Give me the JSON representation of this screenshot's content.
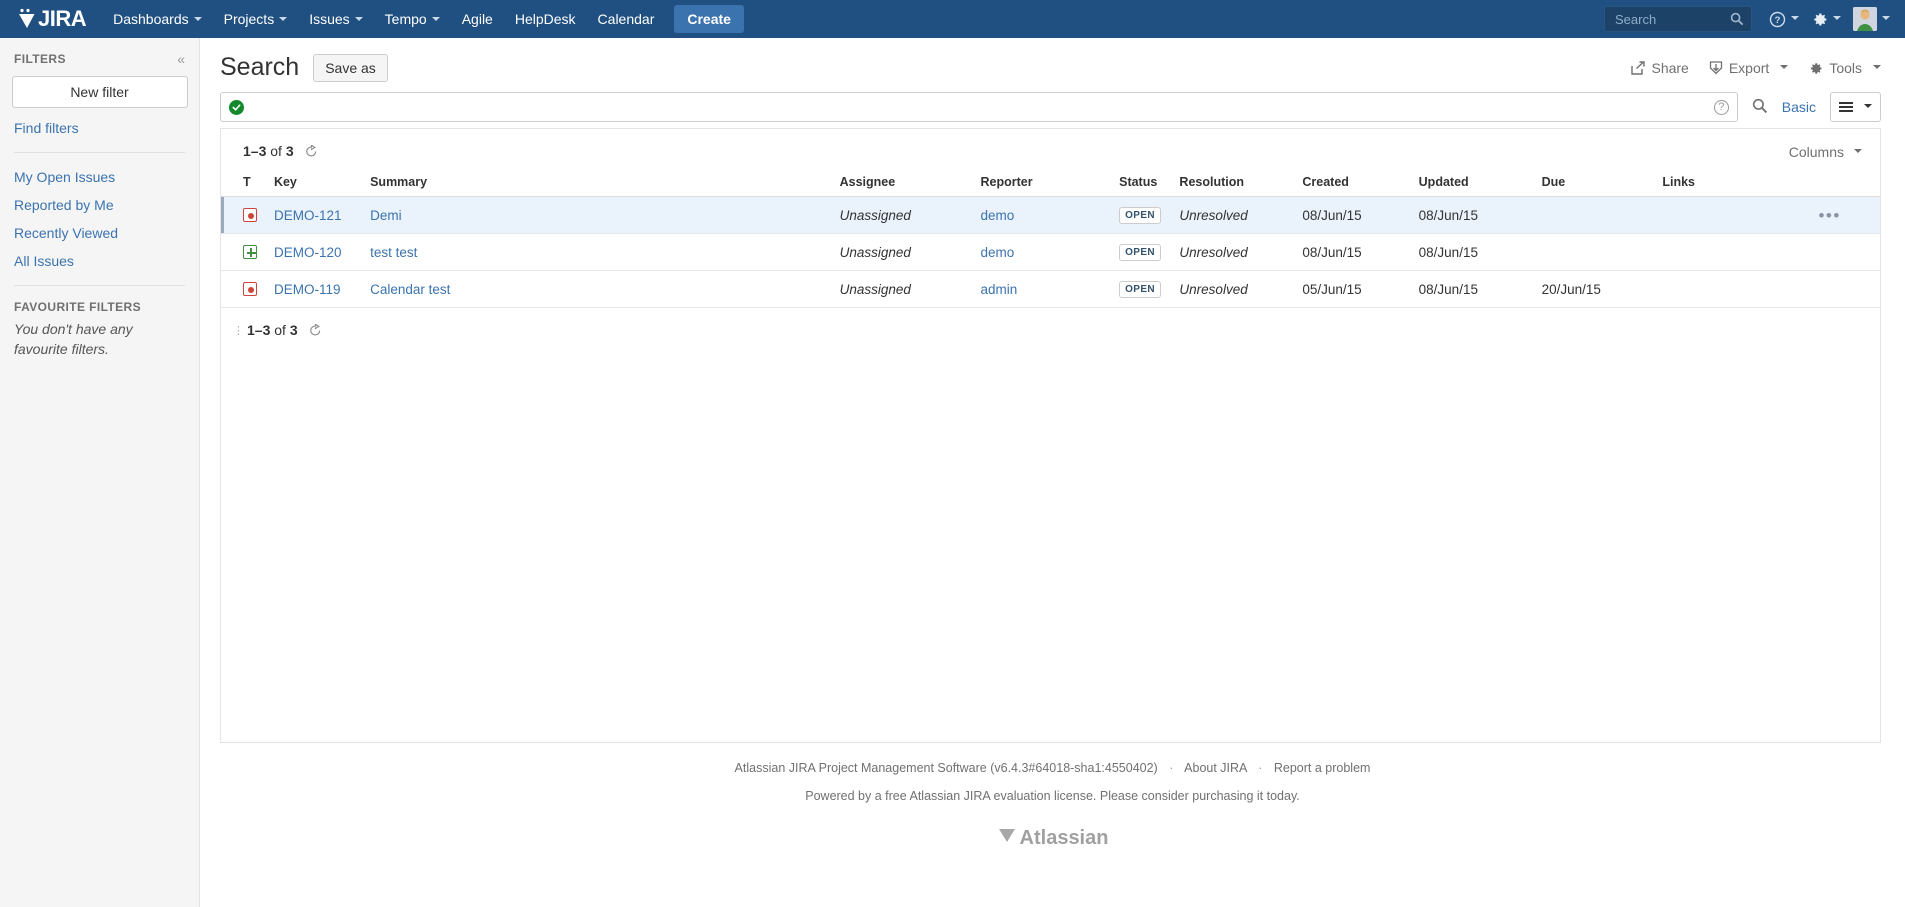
{
  "topnav": {
    "logo_text": "JIRA",
    "items": [
      {
        "label": "Dashboards",
        "has_caret": true
      },
      {
        "label": "Projects",
        "has_caret": true
      },
      {
        "label": "Issues",
        "has_caret": true
      },
      {
        "label": "Tempo",
        "has_caret": true
      },
      {
        "label": "Agile",
        "has_caret": false
      },
      {
        "label": "HelpDesk",
        "has_caret": false
      },
      {
        "label": "Calendar",
        "has_caret": false
      }
    ],
    "create_label": "Create",
    "search_placeholder": "Search",
    "search_value": "",
    "help_icon": "question-circle-icon",
    "settings_icon": "gear-icon",
    "profile_icon": "avatar-icon",
    "brand_color": "#205081",
    "create_color": "#3b73af"
  },
  "sidebar": {
    "title": "FILTERS",
    "collapse_icon": "«",
    "new_filter_label": "New filter",
    "find_filters_label": "Find filters",
    "items": [
      {
        "label": "My Open Issues"
      },
      {
        "label": "Reported by Me"
      },
      {
        "label": "Recently Viewed"
      },
      {
        "label": "All Issues"
      }
    ],
    "favourites_title": "FAVOURITE FILTERS",
    "favourites_empty": "You don't have any favourite filters."
  },
  "header": {
    "page_title": "Search",
    "save_as_label": "Save as",
    "actions": [
      {
        "label": "Share",
        "icon": "share-icon"
      },
      {
        "label": "Export",
        "icon": "export-icon",
        "has_caret": true
      },
      {
        "label": "Tools",
        "icon": "gear-icon",
        "has_caret": true
      }
    ]
  },
  "jql": {
    "value": "",
    "placeholder": "",
    "valid_icon": "green-check-icon",
    "help_icon": "question-mark-icon",
    "search_icon": "magnifier-icon",
    "basic_label": "Basic",
    "view_toggle_icon": "hamburger-icon",
    "valid_color": "#14892c"
  },
  "results": {
    "count_prefix": "1–3",
    "count_middle": "of",
    "count_total": "3",
    "refresh_icon": "refresh-icon",
    "columns_label": "Columns",
    "columns": [
      "T",
      "Key",
      "Summary",
      "Assignee",
      "Reporter",
      "Status",
      "Resolution",
      "Created",
      "Updated",
      "Due",
      "Links"
    ],
    "rows": [
      {
        "type_icon": "bug-icon",
        "type": "bug",
        "key": "DEMO-121",
        "summary": "Demi",
        "assignee": "Unassigned",
        "reporter": "demo",
        "status": "OPEN",
        "resolution": "Unresolved",
        "created": "08/Jun/15",
        "updated": "08/Jun/15",
        "due": "",
        "links": "",
        "selected": true,
        "actions_icon": "ellipsis-icon"
      },
      {
        "type_icon": "new-feature-icon",
        "type": "feature",
        "key": "DEMO-120",
        "summary": "test test",
        "assignee": "Unassigned",
        "reporter": "demo",
        "status": "OPEN",
        "resolution": "Unresolved",
        "created": "08/Jun/15",
        "updated": "08/Jun/15",
        "due": "",
        "links": "",
        "selected": false,
        "actions_icon": ""
      },
      {
        "type_icon": "bug-icon",
        "type": "bug",
        "key": "DEMO-119",
        "summary": "Calendar test",
        "assignee": "Unassigned",
        "reporter": "admin",
        "status": "OPEN",
        "resolution": "Unresolved",
        "created": "05/Jun/15",
        "updated": "08/Jun/15",
        "due": "20/Jun/15",
        "links": "",
        "selected": false,
        "actions_icon": ""
      }
    ]
  },
  "footer": {
    "version_text": "Atlassian JIRA Project Management Software (v6.4.3#64018-sha1:4550402)",
    "about_label": "About JIRA",
    "report_label": "Report a problem",
    "separator": "·",
    "license_text": "Powered by a free Atlassian JIRA evaluation license. Please consider purchasing it today.",
    "brand_text": "Atlassian"
  }
}
